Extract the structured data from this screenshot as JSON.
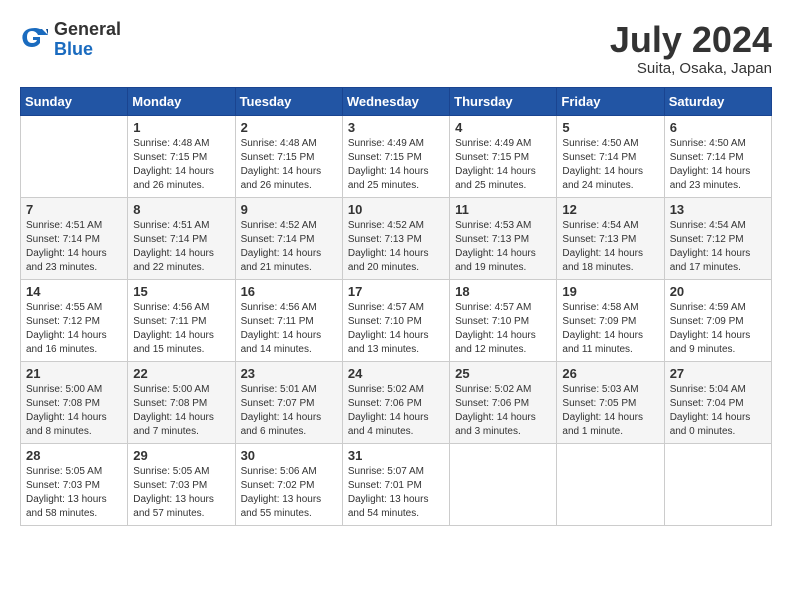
{
  "header": {
    "logo_general": "General",
    "logo_blue": "Blue",
    "month": "July 2024",
    "location": "Suita, Osaka, Japan"
  },
  "weekdays": [
    "Sunday",
    "Monday",
    "Tuesday",
    "Wednesday",
    "Thursday",
    "Friday",
    "Saturday"
  ],
  "weeks": [
    [
      {
        "day": "",
        "info": ""
      },
      {
        "day": "1",
        "info": "Sunrise: 4:48 AM\nSunset: 7:15 PM\nDaylight: 14 hours\nand 26 minutes."
      },
      {
        "day": "2",
        "info": "Sunrise: 4:48 AM\nSunset: 7:15 PM\nDaylight: 14 hours\nand 26 minutes."
      },
      {
        "day": "3",
        "info": "Sunrise: 4:49 AM\nSunset: 7:15 PM\nDaylight: 14 hours\nand 25 minutes."
      },
      {
        "day": "4",
        "info": "Sunrise: 4:49 AM\nSunset: 7:15 PM\nDaylight: 14 hours\nand 25 minutes."
      },
      {
        "day": "5",
        "info": "Sunrise: 4:50 AM\nSunset: 7:14 PM\nDaylight: 14 hours\nand 24 minutes."
      },
      {
        "day": "6",
        "info": "Sunrise: 4:50 AM\nSunset: 7:14 PM\nDaylight: 14 hours\nand 23 minutes."
      }
    ],
    [
      {
        "day": "7",
        "info": "Sunrise: 4:51 AM\nSunset: 7:14 PM\nDaylight: 14 hours\nand 23 minutes."
      },
      {
        "day": "8",
        "info": "Sunrise: 4:51 AM\nSunset: 7:14 PM\nDaylight: 14 hours\nand 22 minutes."
      },
      {
        "day": "9",
        "info": "Sunrise: 4:52 AM\nSunset: 7:14 PM\nDaylight: 14 hours\nand 21 minutes."
      },
      {
        "day": "10",
        "info": "Sunrise: 4:52 AM\nSunset: 7:13 PM\nDaylight: 14 hours\nand 20 minutes."
      },
      {
        "day": "11",
        "info": "Sunrise: 4:53 AM\nSunset: 7:13 PM\nDaylight: 14 hours\nand 19 minutes."
      },
      {
        "day": "12",
        "info": "Sunrise: 4:54 AM\nSunset: 7:13 PM\nDaylight: 14 hours\nand 18 minutes."
      },
      {
        "day": "13",
        "info": "Sunrise: 4:54 AM\nSunset: 7:12 PM\nDaylight: 14 hours\nand 17 minutes."
      }
    ],
    [
      {
        "day": "14",
        "info": "Sunrise: 4:55 AM\nSunset: 7:12 PM\nDaylight: 14 hours\nand 16 minutes."
      },
      {
        "day": "15",
        "info": "Sunrise: 4:56 AM\nSunset: 7:11 PM\nDaylight: 14 hours\nand 15 minutes."
      },
      {
        "day": "16",
        "info": "Sunrise: 4:56 AM\nSunset: 7:11 PM\nDaylight: 14 hours\nand 14 minutes."
      },
      {
        "day": "17",
        "info": "Sunrise: 4:57 AM\nSunset: 7:10 PM\nDaylight: 14 hours\nand 13 minutes."
      },
      {
        "day": "18",
        "info": "Sunrise: 4:57 AM\nSunset: 7:10 PM\nDaylight: 14 hours\nand 12 minutes."
      },
      {
        "day": "19",
        "info": "Sunrise: 4:58 AM\nSunset: 7:09 PM\nDaylight: 14 hours\nand 11 minutes."
      },
      {
        "day": "20",
        "info": "Sunrise: 4:59 AM\nSunset: 7:09 PM\nDaylight: 14 hours\nand 9 minutes."
      }
    ],
    [
      {
        "day": "21",
        "info": "Sunrise: 5:00 AM\nSunset: 7:08 PM\nDaylight: 14 hours\nand 8 minutes."
      },
      {
        "day": "22",
        "info": "Sunrise: 5:00 AM\nSunset: 7:08 PM\nDaylight: 14 hours\nand 7 minutes."
      },
      {
        "day": "23",
        "info": "Sunrise: 5:01 AM\nSunset: 7:07 PM\nDaylight: 14 hours\nand 6 minutes."
      },
      {
        "day": "24",
        "info": "Sunrise: 5:02 AM\nSunset: 7:06 PM\nDaylight: 14 hours\nand 4 minutes."
      },
      {
        "day": "25",
        "info": "Sunrise: 5:02 AM\nSunset: 7:06 PM\nDaylight: 14 hours\nand 3 minutes."
      },
      {
        "day": "26",
        "info": "Sunrise: 5:03 AM\nSunset: 7:05 PM\nDaylight: 14 hours\nand 1 minute."
      },
      {
        "day": "27",
        "info": "Sunrise: 5:04 AM\nSunset: 7:04 PM\nDaylight: 14 hours\nand 0 minutes."
      }
    ],
    [
      {
        "day": "28",
        "info": "Sunrise: 5:05 AM\nSunset: 7:03 PM\nDaylight: 13 hours\nand 58 minutes."
      },
      {
        "day": "29",
        "info": "Sunrise: 5:05 AM\nSunset: 7:03 PM\nDaylight: 13 hours\nand 57 minutes."
      },
      {
        "day": "30",
        "info": "Sunrise: 5:06 AM\nSunset: 7:02 PM\nDaylight: 13 hours\nand 55 minutes."
      },
      {
        "day": "31",
        "info": "Sunrise: 5:07 AM\nSunset: 7:01 PM\nDaylight: 13 hours\nand 54 minutes."
      },
      {
        "day": "",
        "info": ""
      },
      {
        "day": "",
        "info": ""
      },
      {
        "day": "",
        "info": ""
      }
    ]
  ]
}
